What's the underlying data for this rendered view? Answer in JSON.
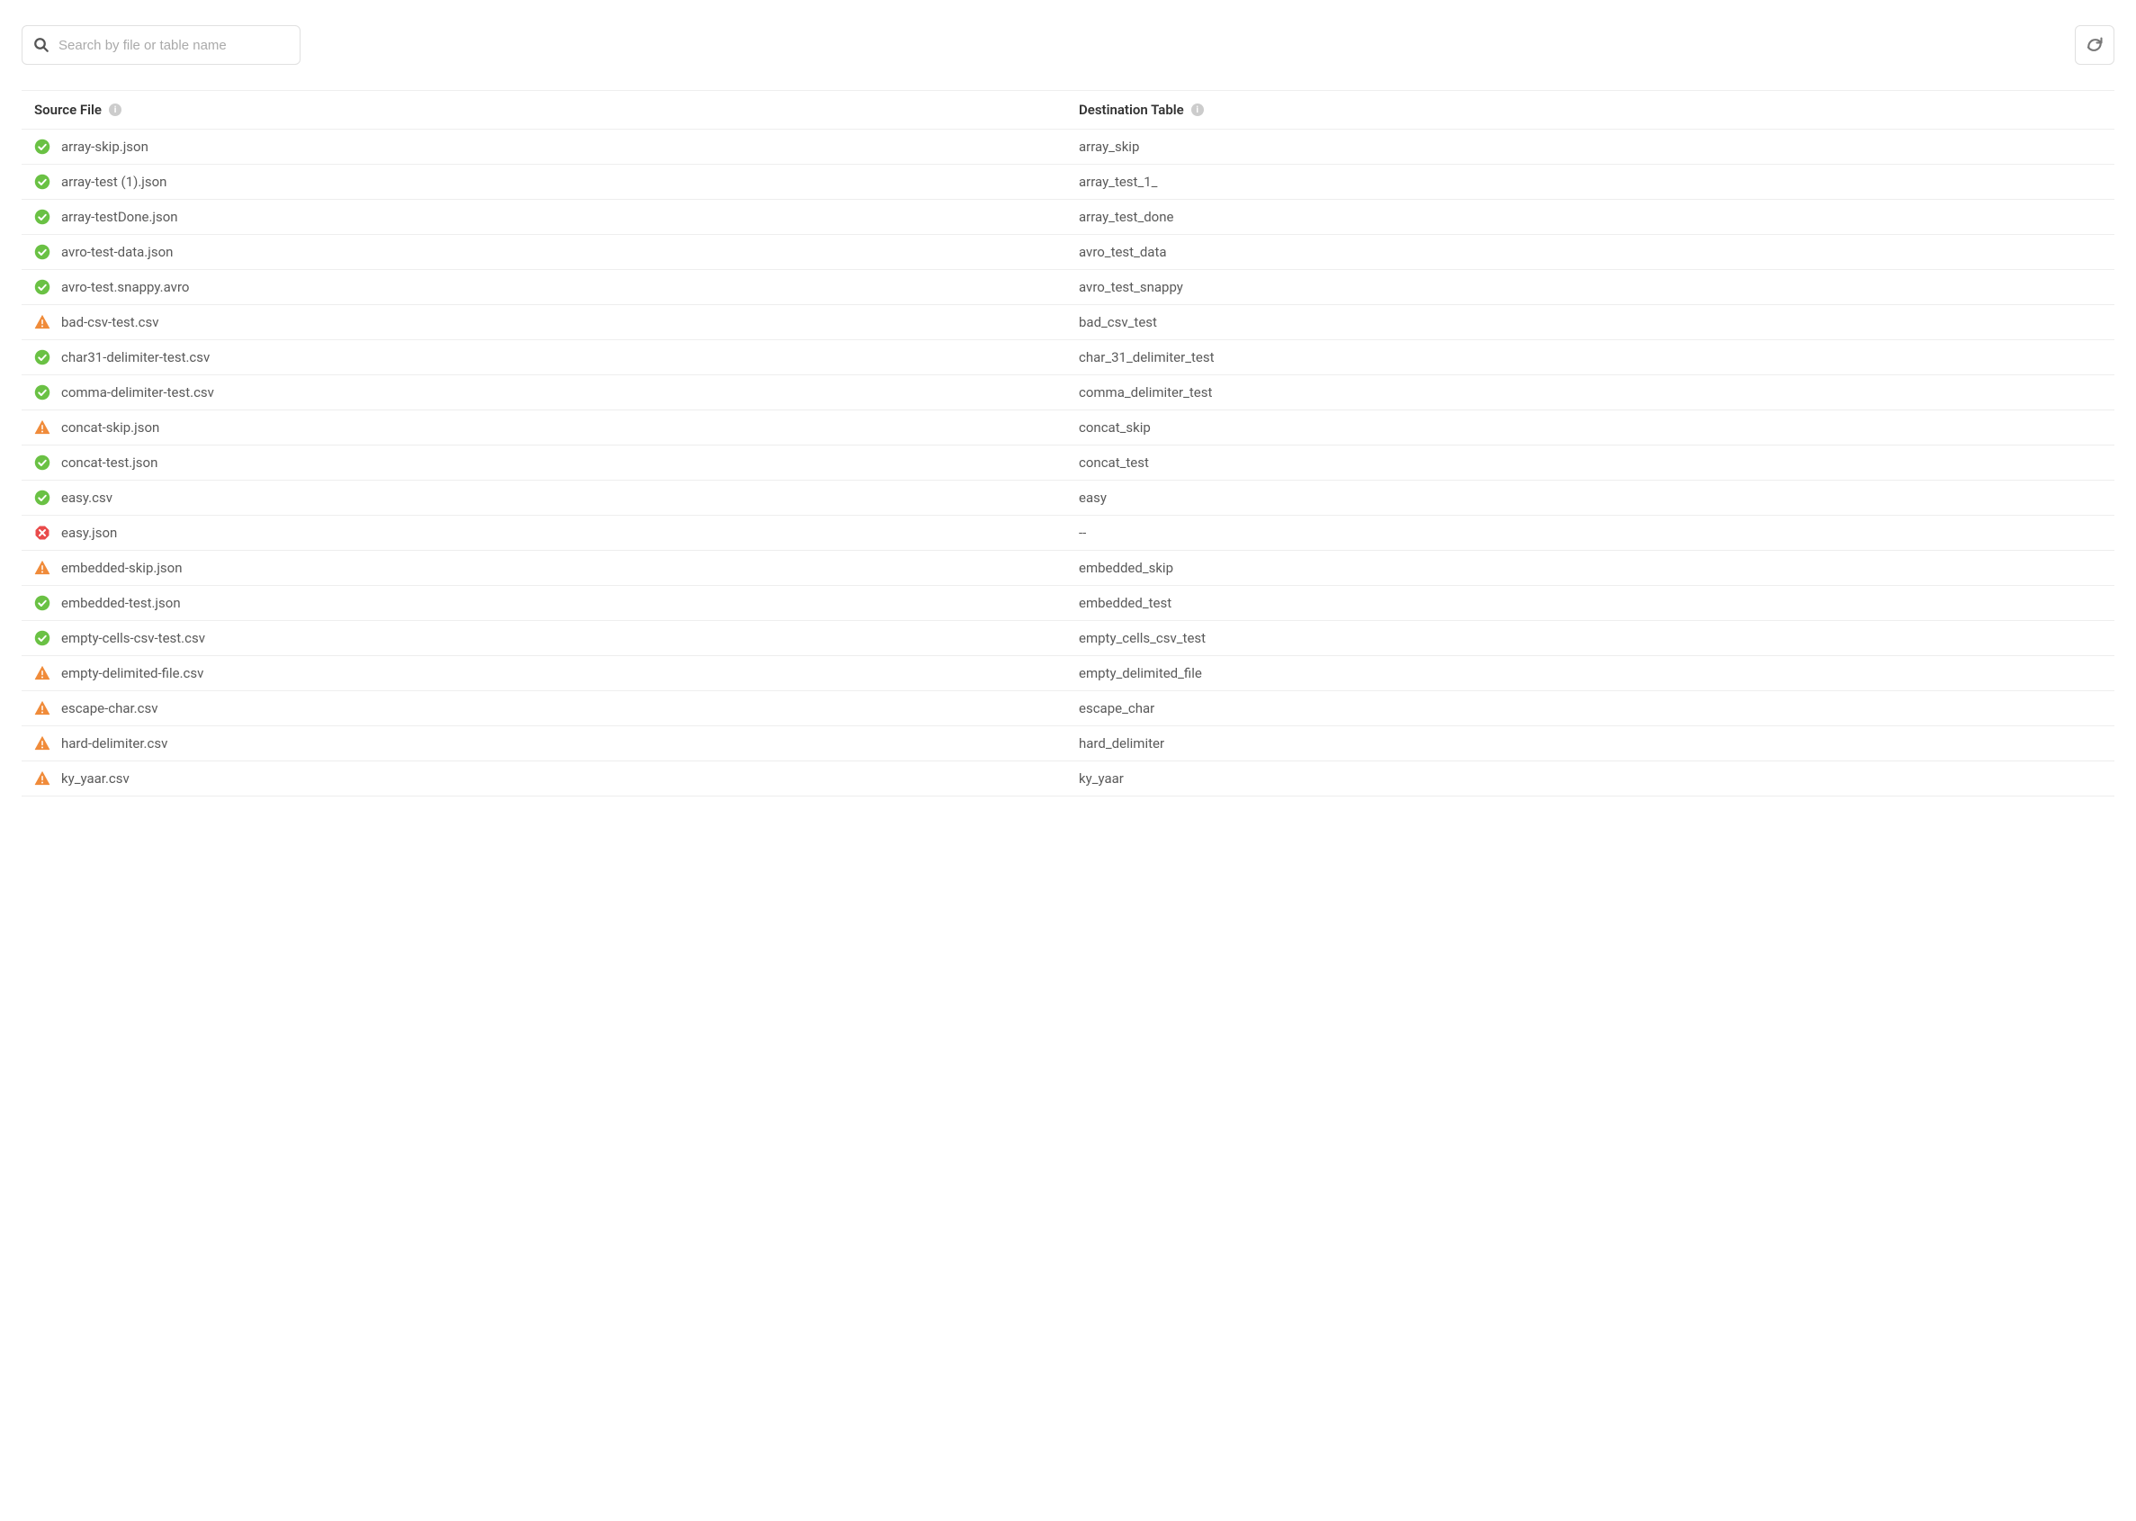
{
  "search": {
    "placeholder": "Search by file or table name"
  },
  "columns": {
    "source": "Source File",
    "destination": "Destination Table"
  },
  "empty_value": "--",
  "rows": [
    {
      "status": "success",
      "source": "array-skip.json",
      "destination": "array_skip"
    },
    {
      "status": "success",
      "source": "array-test (1).json",
      "destination": "array_test_1_"
    },
    {
      "status": "success",
      "source": "array-testDone.json",
      "destination": "array_test_done"
    },
    {
      "status": "success",
      "source": "avro-test-data.json",
      "destination": "avro_test_data"
    },
    {
      "status": "success",
      "source": "avro-test.snappy.avro",
      "destination": "avro_test_snappy"
    },
    {
      "status": "warning",
      "source": "bad-csv-test.csv",
      "destination": "bad_csv_test"
    },
    {
      "status": "success",
      "source": "char31-delimiter-test.csv",
      "destination": "char_31_delimiter_test"
    },
    {
      "status": "success",
      "source": "comma-delimiter-test.csv",
      "destination": "comma_delimiter_test"
    },
    {
      "status": "warning",
      "source": "concat-skip.json",
      "destination": "concat_skip"
    },
    {
      "status": "success",
      "source": "concat-test.json",
      "destination": "concat_test"
    },
    {
      "status": "success",
      "source": "easy.csv",
      "destination": "easy"
    },
    {
      "status": "error",
      "source": "easy.json",
      "destination": "--"
    },
    {
      "status": "warning",
      "source": "embedded-skip.json",
      "destination": "embedded_skip"
    },
    {
      "status": "success",
      "source": "embedded-test.json",
      "destination": "embedded_test"
    },
    {
      "status": "success",
      "source": "empty-cells-csv-test.csv",
      "destination": "empty_cells_csv_test"
    },
    {
      "status": "warning",
      "source": "empty-delimited-file.csv",
      "destination": "empty_delimited_file"
    },
    {
      "status": "warning",
      "source": "escape-char.csv",
      "destination": "escape_char"
    },
    {
      "status": "warning",
      "source": "hard-delimiter.csv",
      "destination": "hard_delimiter"
    },
    {
      "status": "warning",
      "source": "ky_yaar.csv",
      "destination": "ky_yaar"
    }
  ],
  "colors": {
    "success": "#6ac144",
    "warning": "#f08b3a",
    "error": "#e94b4b",
    "icon_grey": "#777"
  }
}
